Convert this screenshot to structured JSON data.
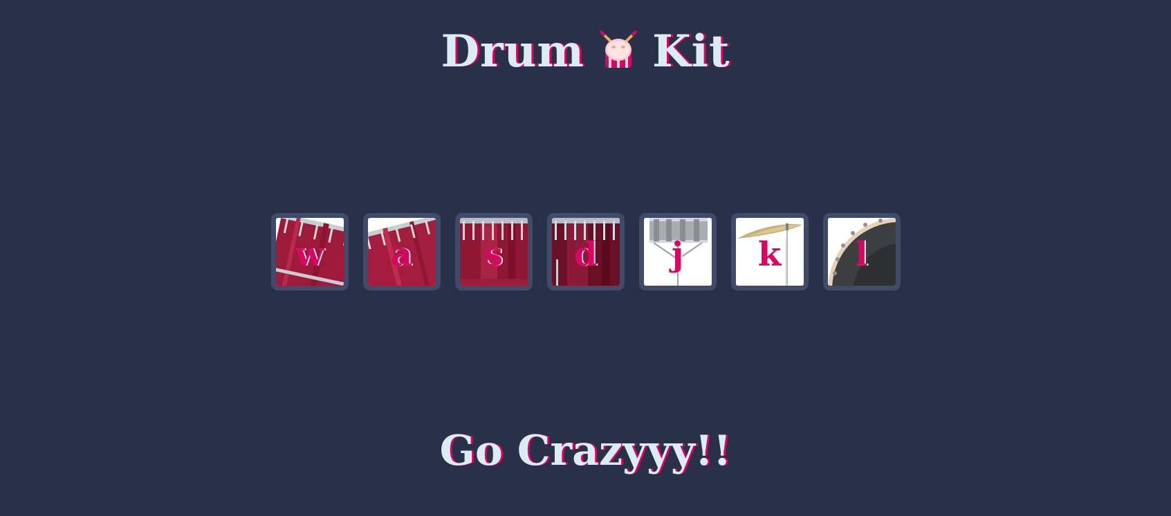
{
  "header": {
    "title_left": "Drum",
    "title_right": "Kit",
    "emoji_icon": "drum-icon"
  },
  "drums": [
    {
      "key": "w",
      "icon": "tom1-icon"
    },
    {
      "key": "a",
      "icon": "tom2-icon"
    },
    {
      "key": "s",
      "icon": "tom3-icon"
    },
    {
      "key": "d",
      "icon": "tom4-icon"
    },
    {
      "key": "j",
      "icon": "snare-icon"
    },
    {
      "key": "k",
      "icon": "crash-icon"
    },
    {
      "key": "l",
      "icon": "kick-icon"
    }
  ],
  "footer": {
    "text": "Go Crazyyy!!"
  },
  "colors": {
    "background": "#283149",
    "text": "#DBEDF3",
    "accent": "#DA0463",
    "drum_border": "#404B69"
  }
}
